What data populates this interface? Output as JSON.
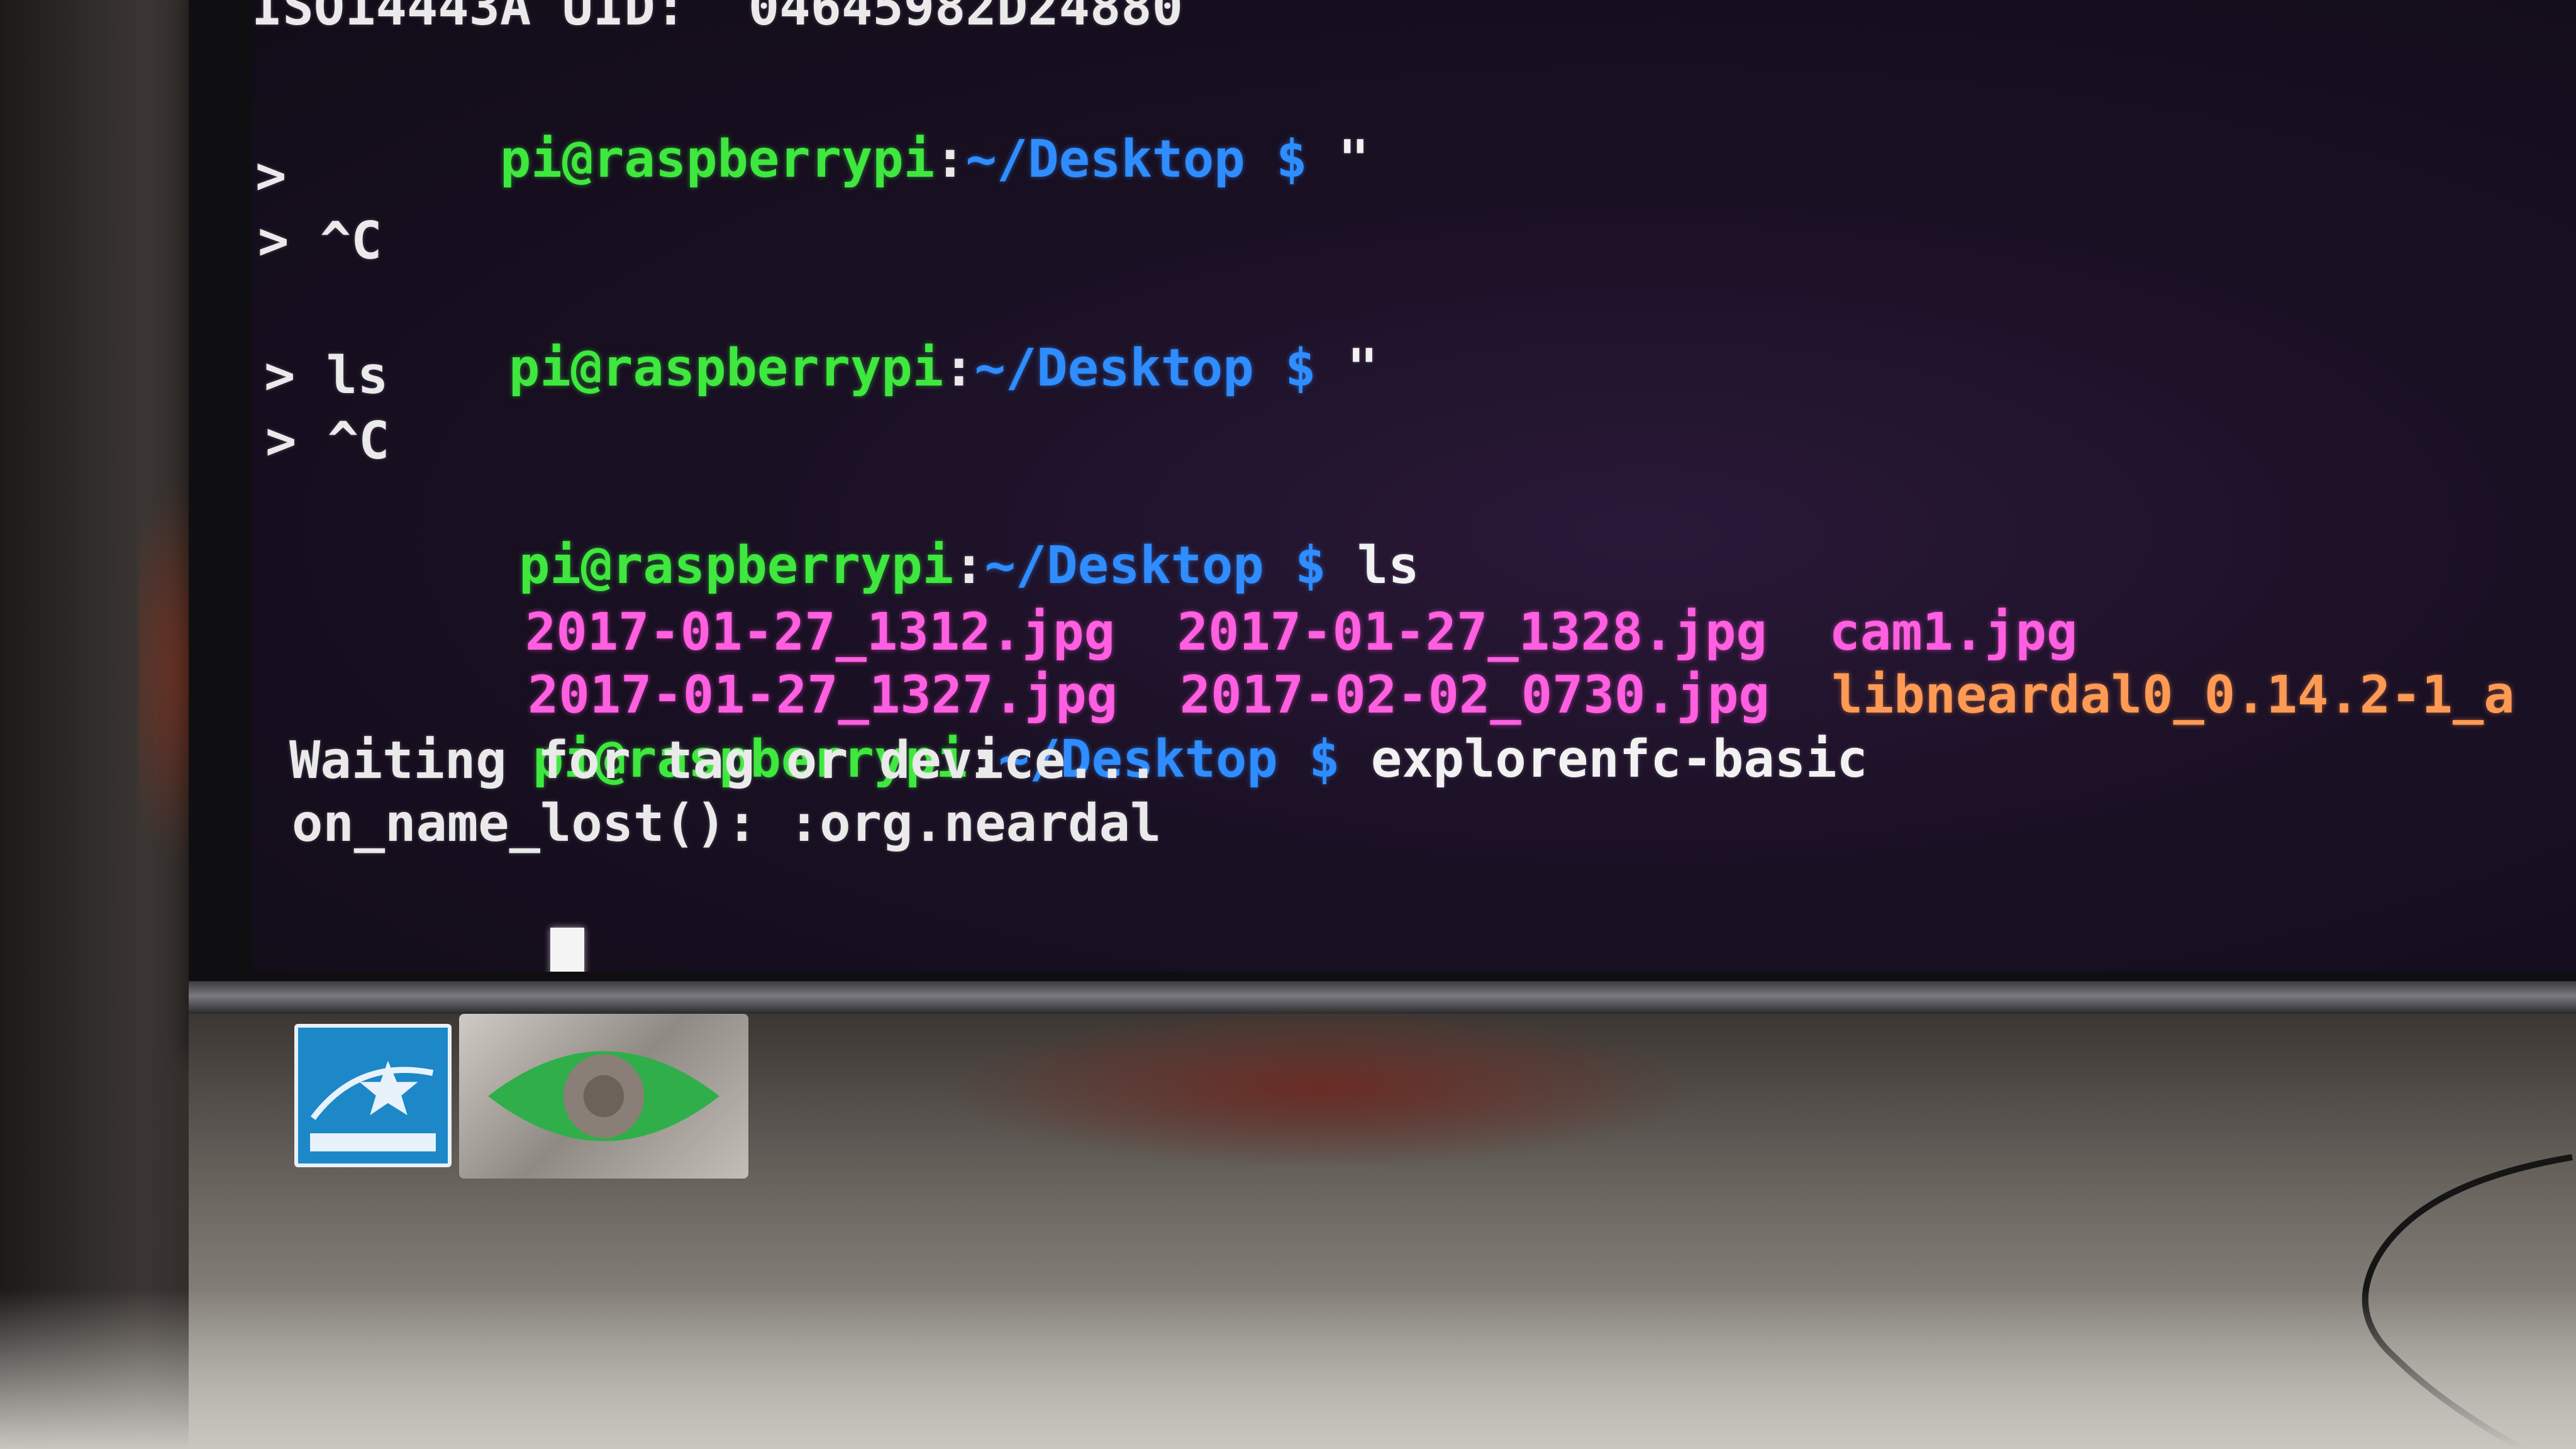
{
  "terminal": {
    "lines": {
      "l0": {
        "text": "ISO14443A UID:  04645982D24880"
      },
      "l1": {
        "user": "pi@raspberrypi",
        "sep": ":",
        "path": "~/Desktop $",
        "cmd": " \""
      },
      "l2": {
        "text": ">"
      },
      "l3": {
        "text": "> ^C"
      },
      "l4": {
        "user": "pi@raspberrypi",
        "sep": ":",
        "path": "~/Desktop $",
        "cmd": " \""
      },
      "l5": {
        "text": "> ls"
      },
      "l6": {
        "text": "> ^C"
      },
      "l7": {
        "user": "pi@raspberrypi",
        "sep": ":",
        "path": "~/Desktop $",
        "cmd": " ls"
      },
      "l8": {
        "f1": "2017-01-27_1312.jpg",
        "f2": "2017-01-27_1328.jpg",
        "f3": "cam1.jpg"
      },
      "l9": {
        "f1": "2017-01-27_1327.jpg",
        "f2": "2017-02-02_0730.jpg",
        "f3": "libneardal0_0.14.2-1_a"
      },
      "l10": {
        "user": "pi@raspberrypi",
        "sep": ":",
        "path": "~/Desktop $",
        "cmd": " explorenfc-basic"
      },
      "l11": {
        "text": "Waiting for tag or device..."
      },
      "l12": {
        "text": "on_name_lost(): :org.neardal"
      }
    },
    "colors": {
      "prompt_user": "#3ee83e",
      "prompt_path": "#2f8dff",
      "file_jpg": "#ff5fe0",
      "file_deb": "#ff9a55",
      "text": "#eaeaea",
      "background": "#140d1c"
    }
  },
  "stickers": {
    "energy_star_icon": "energy-star-logo-icon",
    "eye_icon": "green-eye-sticker-icon"
  }
}
